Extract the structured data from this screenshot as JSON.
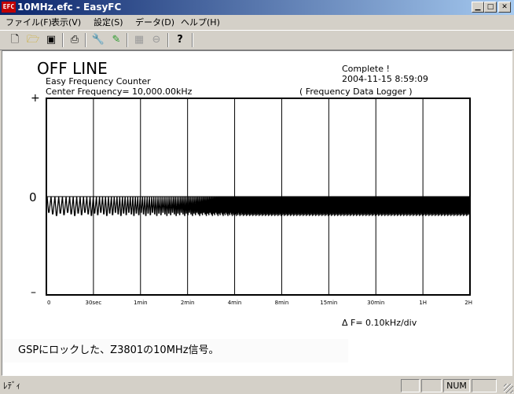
{
  "window": {
    "icon_text": "EFC",
    "title": "10MHz.efc - EasyFC"
  },
  "menu": [
    "ファイル(F)",
    "表示(V)",
    "設定(S)",
    "データ(D)",
    "ヘルプ(H)"
  ],
  "toolbar_icons": [
    "new-icon",
    "open-icon",
    "save-icon",
    "print-icon",
    "wrench-icon",
    "pen-icon",
    "grid-icon",
    "stop-icon",
    "help-icon"
  ],
  "header": {
    "mode": "OFF LINE",
    "app_name": "Easy Frequency Counter",
    "center_frequency": "Center Frequency= 10,000.00kHz",
    "status": "Complete !",
    "timestamp": "2004-11-15  8:59:09",
    "logger": "( Frequency Data Logger )"
  },
  "chart_data": {
    "type": "line",
    "y_labels": {
      "top": "+",
      "middle": "0",
      "bottom": "–"
    },
    "x_ticks": [
      "0",
      "30sec",
      "1min",
      "2min",
      "4min",
      "8min",
      "15min",
      "30min",
      "1H",
      "2H"
    ],
    "resolution": "Δ F=    0.10kHz/div",
    "grid": true
  },
  "caption": "GSPにロックした、Z3801の10MHz信号。",
  "statusbar": {
    "text": "ﾚﾃﾞｨ",
    "num": "NUM"
  }
}
